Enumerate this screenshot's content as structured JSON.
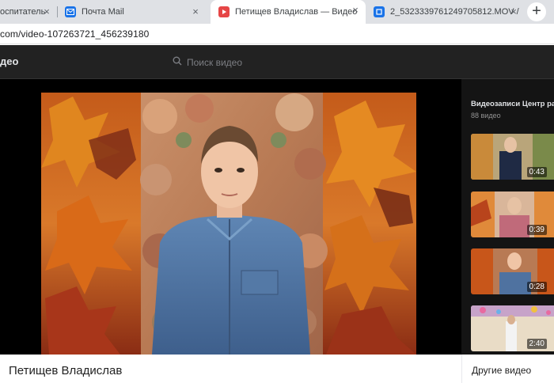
{
  "browser": {
    "tabs": [
      {
        "title": "оспитатель",
        "favicon": "site-icon"
      },
      {
        "title": "Почта Mail",
        "favicon": "mail-icon",
        "color": "#1a73e8"
      },
      {
        "title": "Петищев Владислав — Видео",
        "favicon": "video-icon",
        "color": "#e64646",
        "active": true
      },
      {
        "title": "2_5323339761249705812.MOV /",
        "favicon": "file-icon",
        "color": "#1a73e8"
      }
    ],
    "close_glyph": "×",
    "new_tab_glyph": "+",
    "url": "com/video-107263721_456239180"
  },
  "site": {
    "title": "део",
    "search_placeholder": "Поиск видео"
  },
  "sidebar": {
    "title": "Видеозаписи Центр ра",
    "count": "88 видео",
    "items": [
      {
        "duration": "0:43"
      },
      {
        "duration": "0:39"
      },
      {
        "duration": "0:28"
      },
      {
        "duration": "2:40"
      }
    ]
  },
  "video": {
    "title": "Петищев Владислав"
  },
  "other_videos_label": "Другие видео",
  "colors": {
    "tabbar": "#dfe1e5",
    "header": "#222222",
    "sidebar": "#141414",
    "accent_red": "#e64646"
  }
}
